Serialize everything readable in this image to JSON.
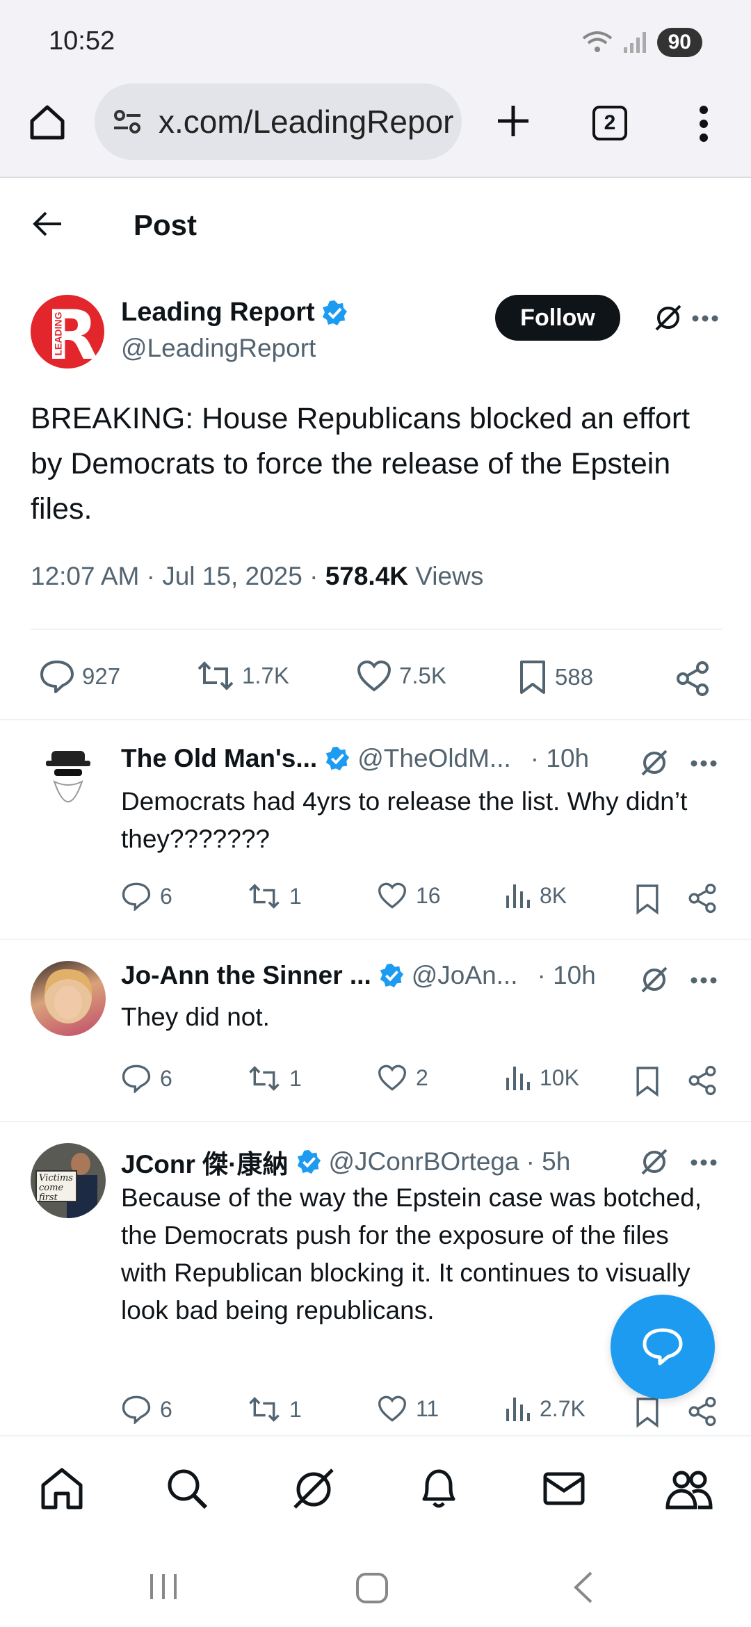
{
  "status_bar": {
    "time": "10:52",
    "battery": "90"
  },
  "browser": {
    "url": "x.com/LeadingRepor",
    "tab_count": "2"
  },
  "header": {
    "title": "Post"
  },
  "main_post": {
    "author_name": "Leading Report",
    "author_handle": "@LeadingReport",
    "follow_label": "Follow",
    "logo_letter": "R",
    "logo_text": "LEADING",
    "text": "BREAKING: House Republicans blocked an effort by Democrats to force the release of the Epstein files.",
    "timestamp": "12:07 AM · Jul 15, 2025 · ",
    "views_count": "578.4K",
    "views_label": " Views",
    "replies": "927",
    "reposts": "1.7K",
    "likes": "7.5K",
    "bookmarks": "588"
  },
  "replies": [
    {
      "name": "The Old Man's...",
      "handle": "@TheOldM...",
      "time": "· 10h",
      "text": "Democrats had 4yrs to release the list. Why didn’t they???????",
      "replies": "6",
      "reposts": "1",
      "likes": "16",
      "views": "8K"
    },
    {
      "name": "Jo-Ann the Sinner ...",
      "handle": "@JoAn...",
      "time": "· 10h",
      "text": "They did not.",
      "replies": "6",
      "reposts": "1",
      "likes": "2",
      "views": "10K"
    },
    {
      "name": "JConr 傑·康納",
      "handle": "@JConrBOrtega",
      "time": "· 5h",
      "text": "Because of the way the Epstein case was botched, the Democrats push for the exposure of the files with Republican blocking it.  It continues to visually look bad being republicans.",
      "replies": "6",
      "reposts": "1",
      "likes": "11",
      "views": "2.7K",
      "avatar_sign": "Victims come first"
    }
  ],
  "colors": {
    "accent": "#1d9bf0",
    "text": "#0f1419",
    "muted": "#536471",
    "brand_red": "#e3262b"
  }
}
